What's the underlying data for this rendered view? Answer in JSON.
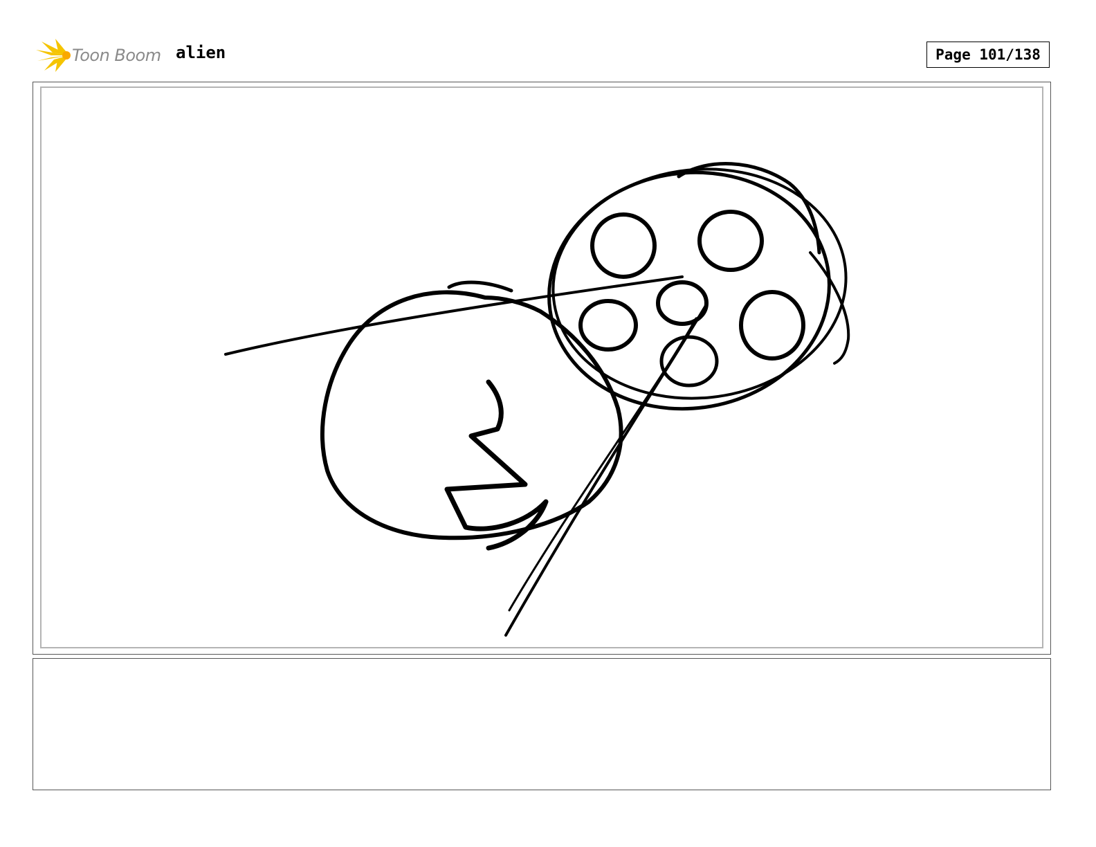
{
  "header": {
    "logo_text": "Toon Boom",
    "project_title": "alien",
    "page_label": "Page 101/138"
  },
  "panel": {
    "icon": "storyboard-sketch-alien-film-reel"
  },
  "caption": {
    "text": ""
  },
  "colors": {
    "logo_star": "#f5c400",
    "logo_text": "#8a8a8a",
    "ink": "#000000",
    "frame_inner": "#b4b4b4"
  }
}
